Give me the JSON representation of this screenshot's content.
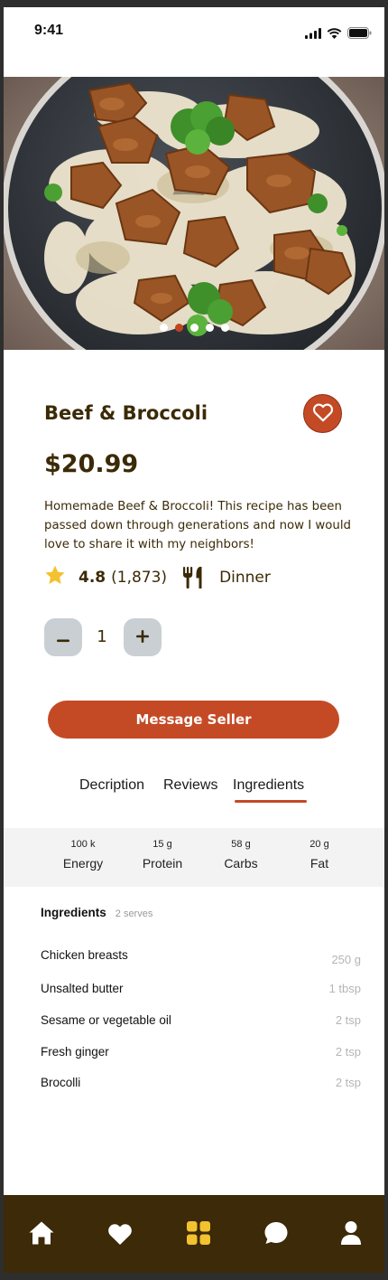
{
  "status_bar": {
    "time": "9:41",
    "icons": [
      "signal-icon",
      "wifi-icon",
      "battery-icon"
    ]
  },
  "hero": {
    "image": "chicken-broccoli-rice-skillet-photo",
    "carousel_count": 5,
    "carousel_active": 1
  },
  "product": {
    "title": "Beef & Broccoli",
    "price": "$20.99",
    "description": "Homemade Beef & Broccoli! This recipe has been passed down through generations and now I would love to share it with my neighbors!",
    "rating": "4.8",
    "rating_count": "(1,873)",
    "category": "Dinner",
    "category_icon": "fork-knife-icon",
    "rating_icon": "star-icon",
    "favorite_icon": "heart-outline-icon"
  },
  "quantity": {
    "value": "1",
    "decrement_icon": "minus-icon",
    "increment_icon": "plus-icon"
  },
  "cta": {
    "label": "Message Seller"
  },
  "tabs": [
    {
      "label": "Decription",
      "active": false
    },
    {
      "label": "Reviews",
      "active": false
    },
    {
      "label": "Ingredients",
      "active": true
    }
  ],
  "nutrition": [
    {
      "value": "100 k",
      "label": "Energy"
    },
    {
      "value": "15 g",
      "label": "Protein"
    },
    {
      "value": "58 g",
      "label": "Carbs"
    },
    {
      "value": "20 g",
      "label": "Fat"
    }
  ],
  "ingredients": {
    "title": "Ingredients",
    "serves": "2 serves",
    "items": [
      {
        "name": "Chicken breasts",
        "qty": "250 g"
      },
      {
        "name": "Unsalted butter",
        "qty": "1 tbsp"
      },
      {
        "name": "Sesame or vegetable oil",
        "qty": "2 tsp"
      },
      {
        "name": "Fresh ginger",
        "qty": "2 tsp"
      },
      {
        "name": "Brocolli",
        "qty": "2 tsp"
      }
    ]
  },
  "bottom_nav": [
    {
      "icon": "home-icon",
      "active": false
    },
    {
      "icon": "heart-icon",
      "active": false
    },
    {
      "icon": "grid-icon",
      "active": true
    },
    {
      "icon": "chat-icon",
      "active": false
    },
    {
      "icon": "profile-icon",
      "active": false
    }
  ],
  "colors": {
    "accent": "#c44a25",
    "text_brown": "#3b2a06",
    "nav_bg": "#3c2a08",
    "nav_active": "#f2c230",
    "star": "#f2c230"
  }
}
